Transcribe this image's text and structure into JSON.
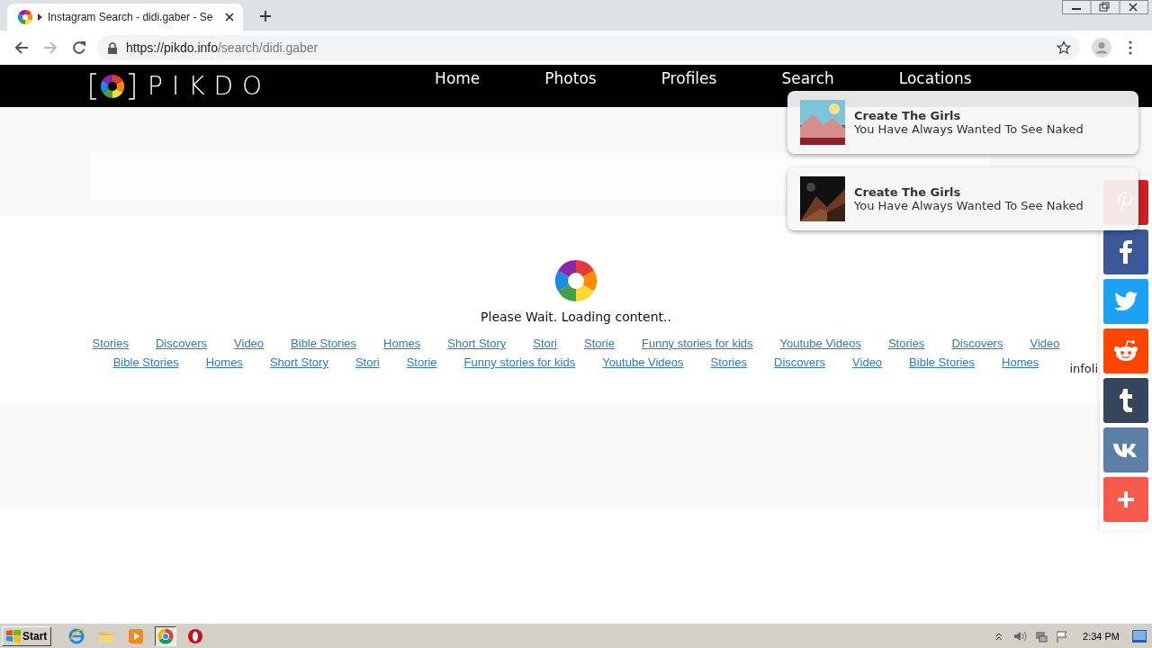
{
  "browser": {
    "tab": {
      "title": "Instagram Search - didi.gaber - Se",
      "selected": true
    },
    "address": {
      "host": "https://pikdo.info",
      "path": "/search/didi.gaber"
    }
  },
  "site": {
    "logo": "PIKDO",
    "nav": [
      {
        "label": "Home"
      },
      {
        "label": "Photos"
      },
      {
        "label": "Profiles"
      },
      {
        "label": "Search"
      },
      {
        "label": "Locations"
      }
    ]
  },
  "loading": {
    "message": "Please Wait. Loading content.."
  },
  "link_rows": [
    [
      "Stories",
      "Discovers",
      "Video",
      "Bible Stories",
      "Homes",
      "Short Story",
      "Stori",
      "Storie",
      "Funny stories for kids",
      "Youtube Videos",
      "Stories",
      "Discovers",
      "Video"
    ],
    [
      "Bible Stories",
      "Homes",
      "Short Story",
      "Stori",
      "Storie",
      "Funny stories for kids",
      "Youtube Videos",
      "Stories",
      "Discovers",
      "Video",
      "Bible Stories",
      "Homes"
    ]
  ],
  "side_text": "infoli",
  "notifications": [
    {
      "title": "Create The Girls",
      "text": "You Have Always Wanted To See Naked"
    },
    {
      "title": "Create The Girls",
      "text": "You Have Always Wanted To See Naked"
    }
  ],
  "share_buttons": [
    {
      "kind": "pinterest",
      "color": "#cb2027"
    },
    {
      "kind": "facebook",
      "color": "#3b5998"
    },
    {
      "kind": "twitter",
      "color": "#1da1f2"
    },
    {
      "kind": "reddit",
      "color": "#ff4500"
    },
    {
      "kind": "tumblr",
      "color": "#35465c"
    },
    {
      "kind": "vk",
      "color": "#5b7fa6"
    },
    {
      "kind": "more",
      "color": "#f65a4a"
    }
  ],
  "taskbar": {
    "start": "Start",
    "apps": [
      {
        "kind": "ie",
        "selected": false
      },
      {
        "kind": "folder",
        "selected": false
      },
      {
        "kind": "media",
        "selected": false
      },
      {
        "kind": "chrome",
        "selected": true
      },
      {
        "kind": "opera",
        "selected": false
      }
    ],
    "time": "2:34 PM"
  }
}
